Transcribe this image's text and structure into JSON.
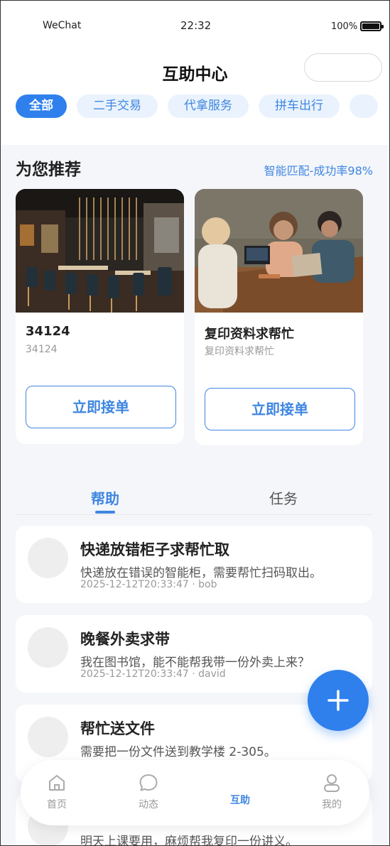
{
  "status_bar": {
    "carrier": "WeChat",
    "time": "22:32",
    "battery_pct": "100%"
  },
  "header": {
    "title": "互助中心"
  },
  "categories": [
    {
      "label": "全部",
      "active": true
    },
    {
      "label": "二手交易",
      "active": false
    },
    {
      "label": "代拿服务",
      "active": false
    },
    {
      "label": "拼车出行",
      "active": false
    },
    {
      "label": "",
      "active": false
    }
  ],
  "recommend": {
    "heading": "为您推荐",
    "match_text": "智能匹配-成功率98%",
    "cards": [
      {
        "title": "34124",
        "subtitle": "34124",
        "button": "立即接单",
        "image": "restaurant-photo"
      },
      {
        "title": "复印资料求帮忙",
        "subtitle": "复印资料求帮忙",
        "button": "立即接单",
        "image": "cafe-meeting-photo"
      }
    ]
  },
  "tabs": [
    {
      "label": "帮助",
      "active": true
    },
    {
      "label": "任务",
      "active": false
    }
  ],
  "posts": [
    {
      "title": "快递放错柜子求帮忙取",
      "desc": "快递放在错误的智能柜，需要帮忙扫码取出。",
      "meta": "2025-12-12T20:33:47 · bob"
    },
    {
      "title": "晚餐外卖求带",
      "desc": "我在图书馆，能不能帮我带一份外卖上来？",
      "meta": "2025-12-12T20:33:47 · david"
    },
    {
      "title": "帮忙送文件",
      "desc": "需要把一份文件送到教学楼 2-305。",
      "meta": ""
    },
    {
      "title": "",
      "desc": "明天上课要用，麻烦帮我复印一份讲义。",
      "meta": ""
    }
  ],
  "fab": {
    "icon": "plus-icon"
  },
  "bottom_nav": [
    {
      "label": "首页",
      "icon": "home-icon",
      "active": false
    },
    {
      "label": "动态",
      "icon": "chat-bubble-icon",
      "active": false
    },
    {
      "label": "互助",
      "icon": "",
      "active": true
    },
    {
      "label": "我的",
      "icon": "user-icon",
      "active": false
    }
  ],
  "colors": {
    "accent": "#2f80ed",
    "accent_text": "#3f86e0",
    "chip_bg": "#eaf3fd",
    "page_bg": "#f4f6fa"
  }
}
